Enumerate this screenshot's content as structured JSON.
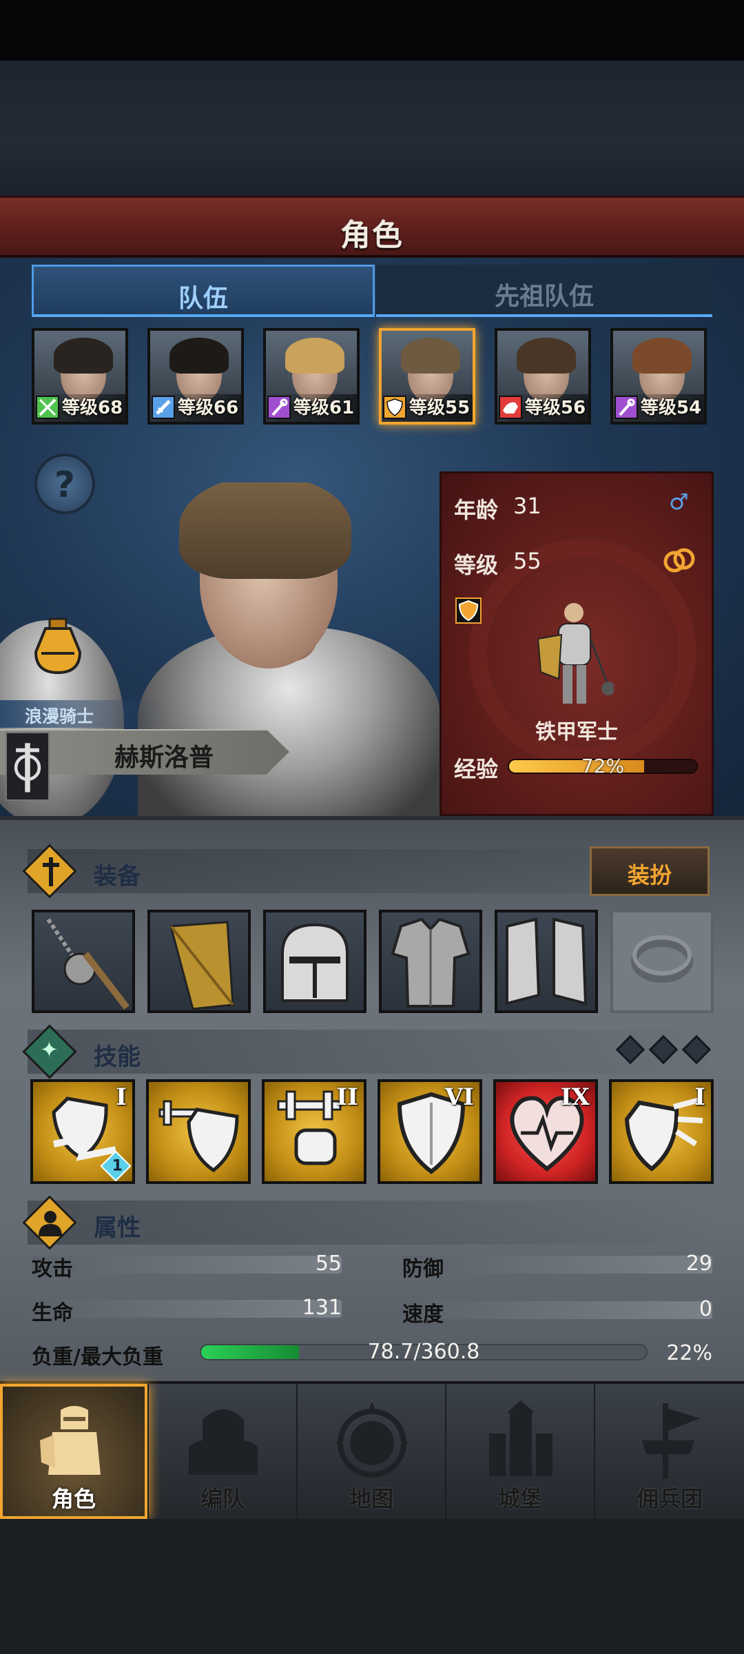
{
  "title": "角色",
  "tabs": [
    {
      "label": "队伍",
      "active": true
    },
    {
      "label": "先祖队伍",
      "active": false
    }
  ],
  "roster": [
    {
      "level": "等级68",
      "role": "bow-sword",
      "badge_color": "#4fc34f",
      "hair": "#2a2420"
    },
    {
      "level": "等级66",
      "role": "sword",
      "badge_color": "#5aa0e8",
      "hair": "#1e1a17"
    },
    {
      "level": "等级61",
      "role": "staff",
      "badge_color": "#a04fd0",
      "hair": "#c9a35b"
    },
    {
      "level": "等级55",
      "role": "shield",
      "badge_color": "#f2a531",
      "hair": "#6e5a40",
      "selected": true
    },
    {
      "level": "等级56",
      "role": "bear",
      "badge_color": "#e23b3b",
      "hair": "#4a3626"
    },
    {
      "level": "等级54",
      "role": "staff",
      "badge_color": "#a04fd0",
      "hair": "#7b4a2a"
    }
  ],
  "hero": {
    "class_name": "浪漫骑士",
    "name": "赫斯洛普"
  },
  "stats": {
    "age_label": "年龄",
    "age": "31",
    "level_label": "等级",
    "level": "55",
    "unit_name": "铁甲军士",
    "exp_label": "经验",
    "exp_text": "72%",
    "exp_fraction": 0.72
  },
  "equipment": {
    "title": "装备",
    "dress_button": "装扮",
    "slots": [
      "flail",
      "shield",
      "helmet",
      "armor",
      "boots",
      "ring-empty"
    ]
  },
  "skills": {
    "title": "技能",
    "items": [
      {
        "roman": "I",
        "icon": "shield-strike",
        "badge": "1"
      },
      {
        "roman": "",
        "icon": "shield-dumbbell"
      },
      {
        "roman": "II",
        "icon": "dumbbell-fist"
      },
      {
        "roman": "VI",
        "icon": "shield"
      },
      {
        "roman": "IX",
        "icon": "heart",
        "red": true
      },
      {
        "roman": "I",
        "icon": "shield-break"
      }
    ]
  },
  "attributes": {
    "title": "属性",
    "attack_label": "攻击",
    "attack": "55",
    "defense_label": "防御",
    "defense": "29",
    "life_label": "生命",
    "life": "131",
    "speed_label": "速度",
    "speed": "0",
    "load_label": "负重/最大负重",
    "load": "78.7/360.8",
    "load_percent": "22%",
    "load_fraction": 0.22
  },
  "nav": [
    {
      "label": "角色",
      "active": true
    },
    {
      "label": "编队"
    },
    {
      "label": "地图"
    },
    {
      "label": "城堡"
    },
    {
      "label": "佣兵团"
    }
  ],
  "colors": {
    "accent_gold": "#f2a531",
    "tab_blue": "#59a9f2",
    "banner_red": "#6a2420",
    "load_green": "#2bd056",
    "skill_gold": "#e0aa25"
  }
}
